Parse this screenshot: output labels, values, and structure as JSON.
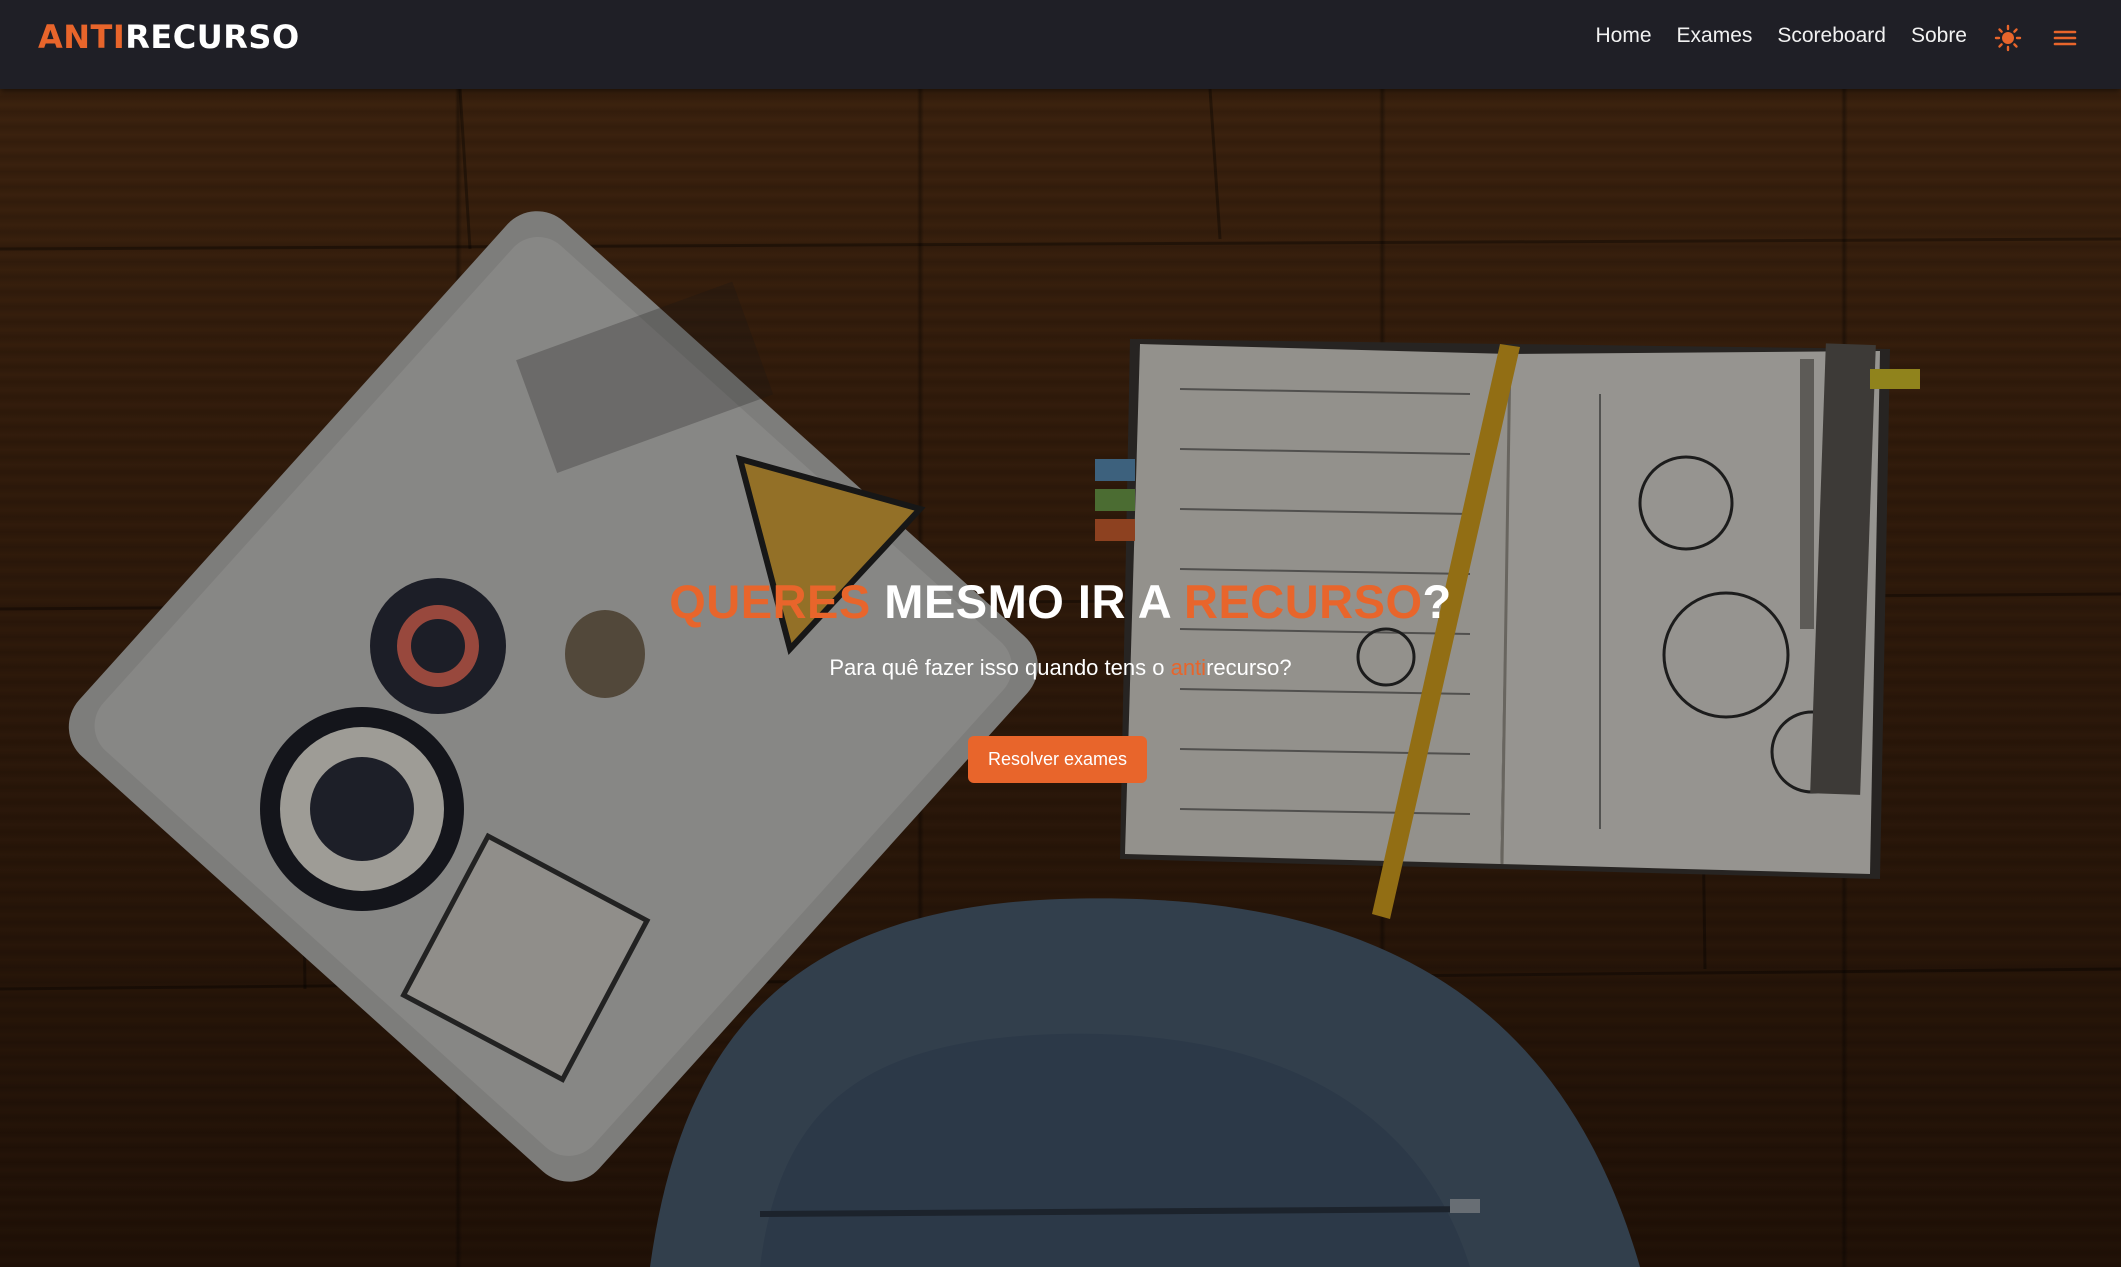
{
  "brand": {
    "prefix": "ANTI",
    "suffix": "RECURSO",
    "accent_color": "#e8652b"
  },
  "nav": {
    "items": [
      {
        "label": "Home"
      },
      {
        "label": "Exames"
      },
      {
        "label": "Scoreboard"
      },
      {
        "label": "Sobre"
      }
    ],
    "theme_toggle_icon": "sun-icon",
    "menu_icon": "hamburger-menu-icon"
  },
  "hero": {
    "title_part1": "QUERES",
    "title_part2": " MESMO IR A ",
    "title_part3": "RECURSO",
    "title_part4": "?",
    "subtitle_part1": "Para quê fazer isso quando tens o ",
    "subtitle_part2": "anti",
    "subtitle_part3": "recurso?",
    "cta_label": "Resolver exames"
  }
}
